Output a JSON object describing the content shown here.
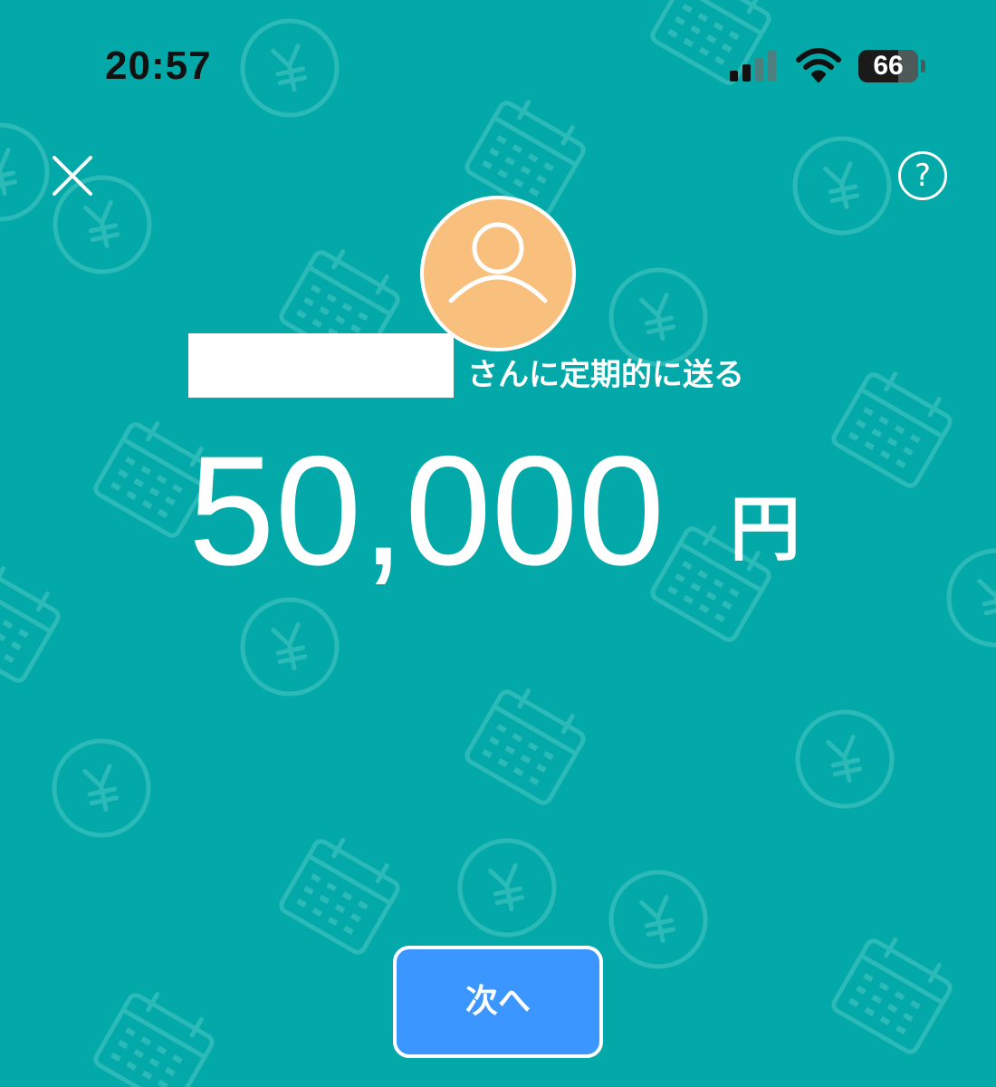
{
  "status_bar": {
    "time": "20:57",
    "battery_level": "66",
    "signal_icon": "cellular-signal-icon",
    "wifi_icon": "wifi-icon"
  },
  "header": {
    "close_icon": "close-icon",
    "help_label": "?"
  },
  "recipient": {
    "avatar_icon": "user-avatar-icon",
    "suffix": "さんに定期的に送る"
  },
  "amount": {
    "value": "50,000",
    "unit": "円"
  },
  "actions": {
    "next_label": "次へ"
  },
  "colors": {
    "background": "#03a9a8",
    "pattern": "#2cbab8",
    "avatar": "#f9bf7c",
    "button": "#3b97ff",
    "text": "#ffffff"
  }
}
